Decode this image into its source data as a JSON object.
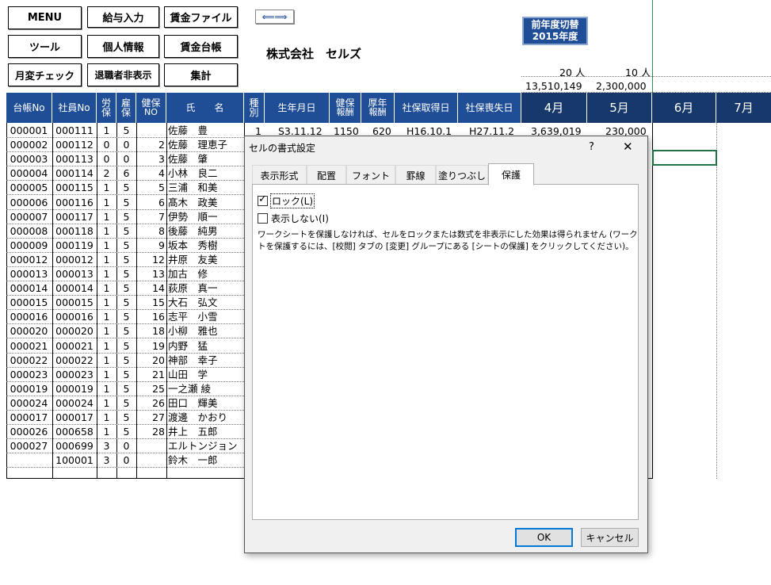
{
  "toolbar": {
    "menu": "MENU",
    "salary_input": "給与入力",
    "wage_file": "賃金ファイル",
    "tools": "ツール",
    "personal_info": "個人情報",
    "wage_ledger": "賃金台帳",
    "monthly_check": "月変チェック",
    "hide_retired": "退職者非表示",
    "total": "集計",
    "arrow": "⟸⟹"
  },
  "company_name": "株式会社　セルズ",
  "switch_year": {
    "line1": "前年度切替",
    "line2": "2015年度"
  },
  "summary": {
    "count_4": "20 人",
    "count_5": "10 人",
    "total_4": "13,510,149",
    "total_5": "2,300,000"
  },
  "headers": {
    "ledger_no": "台帳No",
    "emp_no": "社員No",
    "rou": "労",
    "rou2": "保",
    "koyo": "雇",
    "koyo2": "保",
    "kenpo": "健保",
    "kenpo_no": "NO",
    "name": "氏　　名",
    "kind": "種",
    "kind2": "別",
    "birth": "生年月日",
    "kenpo_pay": "健保",
    "kenpo_pay2": "報酬",
    "kosei_pay": "厚年",
    "kosei_pay2": "報酬",
    "acquire": "社保取得日",
    "lose": "社保喪失日",
    "m4": "4月",
    "m5": "5月",
    "m6": "6月",
    "m7": "7月"
  },
  "first_row_extra": {
    "kind": "1",
    "birth": "S3.11.12",
    "kenpo_pay": "1150",
    "kosei_pay": "620",
    "acquire": "H16.10.1",
    "lose": "H27.11.2",
    "m4": "3,639,019",
    "m5": "230,000"
  },
  "rows": [
    [
      "000001",
      "000111",
      "1",
      "5",
      "",
      "佐藤　豊"
    ],
    [
      "000002",
      "000112",
      "0",
      "0",
      "2",
      "佐藤　理恵子"
    ],
    [
      "000003",
      "000113",
      "0",
      "0",
      "3",
      "佐藤　肇"
    ],
    [
      "000004",
      "000114",
      "2",
      "6",
      "4",
      "小林　良二"
    ],
    [
      "000005",
      "000115",
      "1",
      "5",
      "5",
      "三浦　和美"
    ],
    [
      "000006",
      "000116",
      "1",
      "5",
      "6",
      "髙木　政美"
    ],
    [
      "000007",
      "000117",
      "1",
      "5",
      "7",
      "伊勢　順一"
    ],
    [
      "000008",
      "000118",
      "1",
      "5",
      "8",
      "後藤　純男"
    ],
    [
      "000009",
      "000119",
      "1",
      "5",
      "9",
      "坂本　秀樹"
    ],
    [
      "000012",
      "000012",
      "1",
      "5",
      "12",
      "井原　友美"
    ],
    [
      "000013",
      "000013",
      "1",
      "5",
      "13",
      "加古　修"
    ],
    [
      "000014",
      "000014",
      "1",
      "5",
      "14",
      "荻原　真一"
    ],
    [
      "000015",
      "000015",
      "1",
      "5",
      "15",
      "大石　弘文"
    ],
    [
      "000016",
      "000016",
      "1",
      "5",
      "16",
      "志平　小雪"
    ],
    [
      "000020",
      "000020",
      "1",
      "5",
      "18",
      "小柳　雅也"
    ],
    [
      "000021",
      "000021",
      "1",
      "5",
      "19",
      "内野　猛"
    ],
    [
      "000022",
      "000022",
      "1",
      "5",
      "20",
      "神部　幸子"
    ],
    [
      "000023",
      "000023",
      "1",
      "5",
      "21",
      "山田　学"
    ],
    [
      "000019",
      "000019",
      "1",
      "5",
      "25",
      "一之瀬 綾"
    ],
    [
      "000024",
      "000024",
      "1",
      "5",
      "26",
      "田口　輝美"
    ],
    [
      "000017",
      "000017",
      "1",
      "5",
      "27",
      "渡邊　かおり"
    ],
    [
      "000026",
      "000658",
      "1",
      "5",
      "28",
      "井上　五郎"
    ],
    [
      "000027",
      "000699",
      "3",
      "0",
      "",
      "エルトンジョン"
    ],
    [
      "",
      "100001",
      "3",
      "0",
      "",
      "鈴木　一郎"
    ]
  ],
  "dialog": {
    "title": "セルの書式設定",
    "help": "?",
    "close": "✕",
    "tabs": [
      "表示形式",
      "配置",
      "フォント",
      "罫線",
      "塗りつぶし",
      "保護"
    ],
    "lock_label": "ロック(L)",
    "hidden_label": "表示しない(I)",
    "lock_checked": true,
    "hidden_checked": false,
    "description_line1": "ワークシートを保護しなければ、セルをロックまたは数式を非表示にした効果は得られません (ワークシー",
    "description_line2": "トを保護するには、[校閲] タブの [変更] グループにある [シートの保護] をクリックしてください)。",
    "ok": "OK",
    "cancel": "キャンセル"
  },
  "colors": {
    "header": "#1f4e96",
    "header_dark": "#16386a",
    "dialog_bg": "#f0f0f0"
  }
}
